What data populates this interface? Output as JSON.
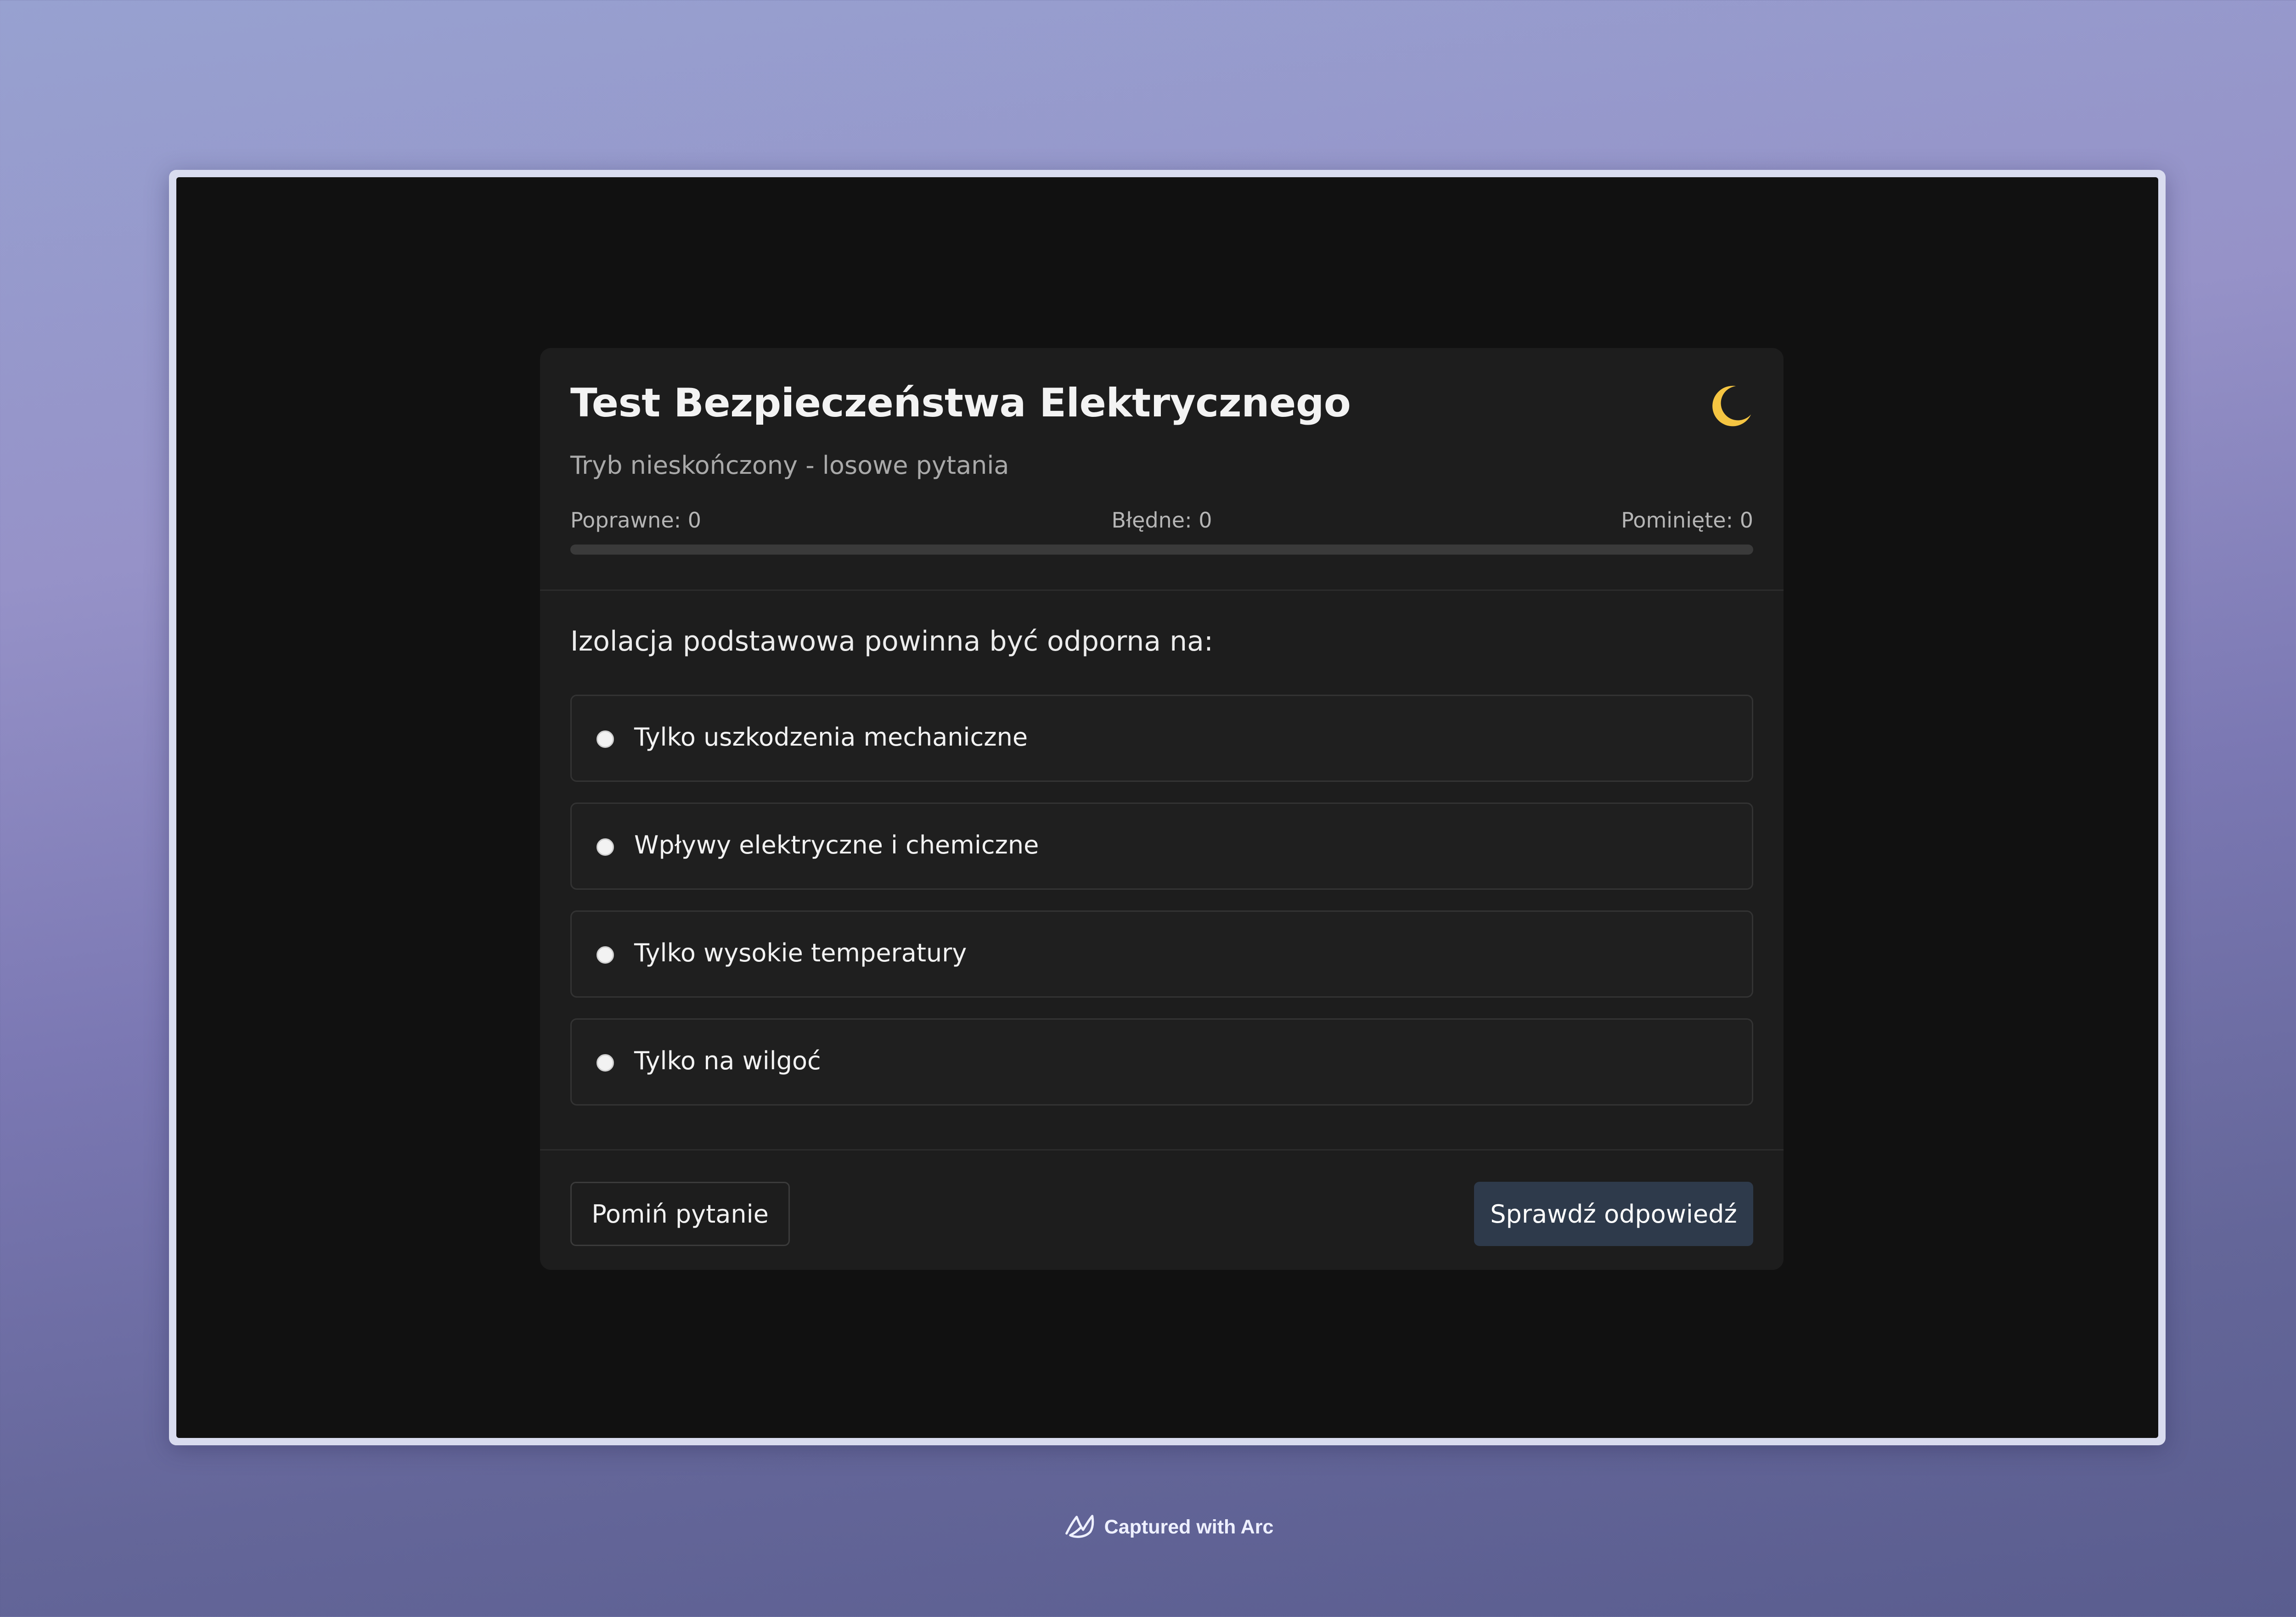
{
  "quiz": {
    "title": "Test Bezpieczeństwa Elektrycznego",
    "subtitle": "Tryb nieskończony - losowe pytania",
    "theme_toggle_icon": "moon-icon",
    "stats": {
      "correct": "Poprawne: 0",
      "wrong": "Błędne: 0",
      "skipped": "Pominięte: 0"
    },
    "progress": 0,
    "question": "Izolacja podstawowa powinna być odporna na:",
    "options": [
      "Tylko uszkodzenia mechaniczne",
      "Wpływy elektryczne i chemiczne",
      "Tylko wysokie temperatury",
      "Tylko na wilgoć"
    ],
    "skip_button": "Pomiń pytanie",
    "check_button": "Sprawdź odpowiedź"
  },
  "badge": {
    "text": "Captured with Arc",
    "icon": "arc-logo-icon"
  },
  "colors": {
    "card_background": "#1d1d1d",
    "page_background": "#111111",
    "check_button": "#2e3a4b",
    "moon": "#f5c542"
  }
}
